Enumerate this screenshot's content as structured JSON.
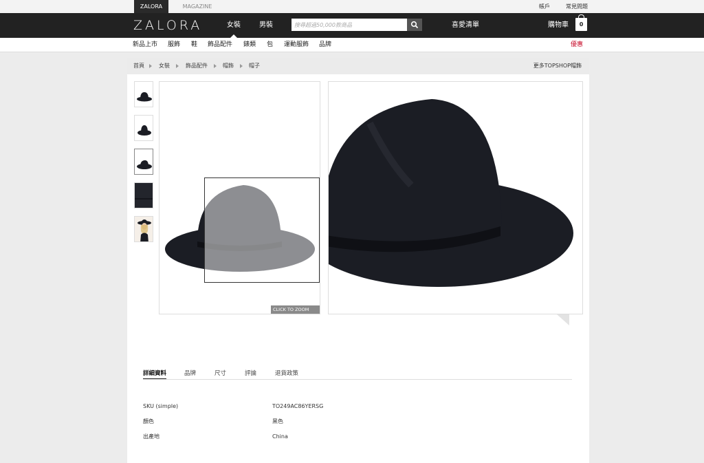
{
  "util": {
    "tabs": [
      "ZALORA",
      "MAGAZINE"
    ],
    "links": [
      "帳戶",
      "常見問題"
    ]
  },
  "header": {
    "logo": "ZALORA",
    "nav": [
      "女裝",
      "男裝"
    ],
    "search_placeholder": "搜尋超過50,000款商品",
    "wishlist": "喜愛清單",
    "cart_label": "購物車",
    "cart_count": "0"
  },
  "categories": [
    "新品上市",
    "服飾",
    "鞋",
    "飾品配件",
    "錶類",
    "包",
    "運動服飾",
    "品牌"
  ],
  "promo": "優惠",
  "breadcrumb": [
    "首頁",
    "女裝",
    "飾品配件",
    "帽飾",
    "帽子"
  ],
  "more_link": "更多TOPSHOP帽飾",
  "gallery": {
    "thumbnails": [
      "hat-side",
      "hat-front",
      "hat-angle",
      "hat-closeup",
      "model-wearing-hat"
    ],
    "selected_thumb": 2,
    "zoom_label": "CLICK TO ZOOM"
  },
  "detail_tabs": [
    "詳細資料",
    "品牌",
    "尺寸",
    "評論",
    "退貨政策"
  ],
  "specs": [
    {
      "label": "SKU (simple)",
      "value": "TO249AC86YERSG"
    },
    {
      "label": "顏色",
      "value": "黑色"
    },
    {
      "label": "出產地",
      "value": "China"
    }
  ],
  "colors": {
    "header": "#222222",
    "promo": "#c8102e",
    "hat": "#1b1d24"
  }
}
